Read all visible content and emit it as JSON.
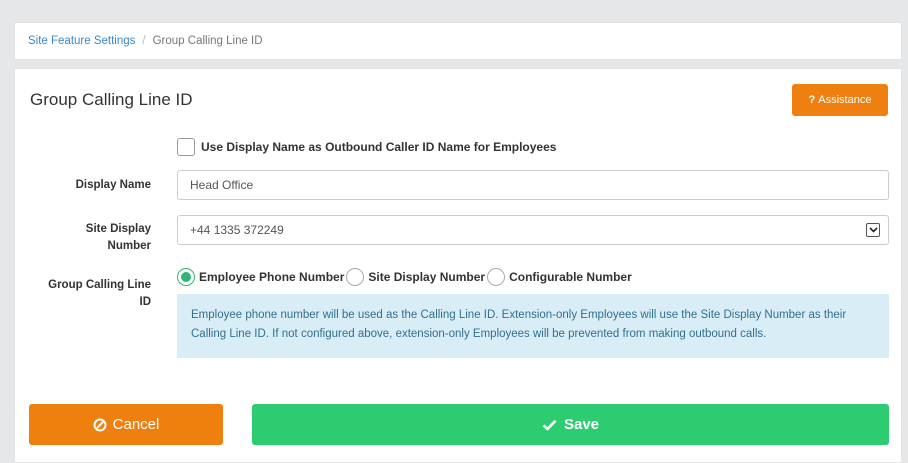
{
  "breadcrumb": {
    "parent": "Site Feature Settings",
    "separator": "/",
    "current": "Group Calling Line ID"
  },
  "panel": {
    "title": "Group Calling Line ID",
    "assistance_label": "Assistance",
    "assistance_icon": "?"
  },
  "form": {
    "use_display_name_label": "Use Display Name as Outbound Caller ID Name for Employees",
    "use_display_name_checked": false,
    "display_name_label": "Display Name",
    "display_name_value": "Head Office",
    "site_display_number_label_1": "Site Display",
    "site_display_number_label_2": "Number",
    "site_display_number_value": "+44 1335 372249",
    "group_clid_label_1": "Group Calling Line",
    "group_clid_label_2": "ID",
    "radio_options": [
      "Employee Phone Number",
      "Site Display Number",
      "Configurable Number"
    ],
    "radio_selected": "Employee Phone Number",
    "info_text": "Employee phone number will be used as the Calling Line ID. Extension-only Employees will use the Site Display Number as their Calling Line ID. If not configured above, extension-only Employees will be prevented from making outbound calls."
  },
  "actions": {
    "cancel_label": "Cancel",
    "save_label": "Save"
  },
  "colors": {
    "orange": "#ef7f0e",
    "green": "#2ecc71",
    "radio_green": "#2eb672",
    "link_blue": "#3a87c8",
    "info_bg": "#d9edf7",
    "info_text": "#31708f"
  }
}
